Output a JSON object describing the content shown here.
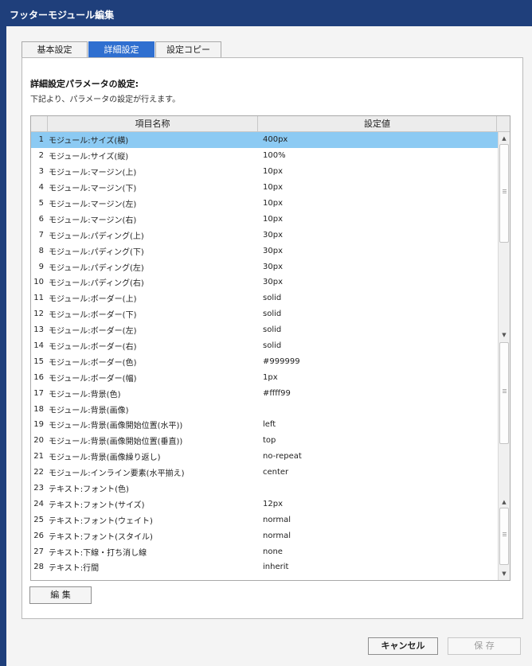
{
  "window": {
    "title": "フッターモジュール編集"
  },
  "tabs": [
    {
      "label": "基本設定",
      "active": false
    },
    {
      "label": "詳細設定",
      "active": true
    },
    {
      "label": "設定コピー",
      "active": false
    }
  ],
  "section": {
    "heading": "詳細設定パラメータの設定:",
    "description": "下記より、パラメータの設定が行えます。"
  },
  "grid": {
    "columns": {
      "name": "項目名称",
      "value": "設定値"
    },
    "rows": [
      {
        "no": "1",
        "name": "モジュール:サイズ(横)",
        "value": "400px",
        "selected": true
      },
      {
        "no": "2",
        "name": "モジュール:サイズ(縦)",
        "value": "100%"
      },
      {
        "no": "3",
        "name": "モジュール:マージン(上)",
        "value": "10px"
      },
      {
        "no": "4",
        "name": "モジュール:マージン(下)",
        "value": "10px"
      },
      {
        "no": "5",
        "name": "モジュール:マージン(左)",
        "value": "10px"
      },
      {
        "no": "6",
        "name": "モジュール:マージン(右)",
        "value": "10px"
      },
      {
        "no": "7",
        "name": "モジュール:パディング(上)",
        "value": "30px"
      },
      {
        "no": "8",
        "name": "モジュール:パディング(下)",
        "value": "30px"
      },
      {
        "no": "9",
        "name": "モジュール:パディング(左)",
        "value": "30px"
      },
      {
        "no": "10",
        "name": "モジュール:パディング(右)",
        "value": "30px"
      },
      {
        "no": "11",
        "name": "モジュール:ボーダー(上)",
        "value": "solid"
      },
      {
        "no": "12",
        "name": "モジュール:ボーダー(下)",
        "value": "solid"
      },
      {
        "no": "13",
        "name": "モジュール:ボーダー(左)",
        "value": "solid"
      },
      {
        "no": "14",
        "name": "モジュール:ボーダー(右)",
        "value": "solid"
      },
      {
        "no": "15",
        "name": "モジュール:ボーダー(色)",
        "value": "#999999"
      },
      {
        "no": "16",
        "name": "モジュール:ボーダー(幅)",
        "value": "1px"
      },
      {
        "no": "17",
        "name": "モジュール:背景(色)",
        "value": "#ffff99"
      },
      {
        "no": "18",
        "name": "モジュール:背景(画像)",
        "value": ""
      },
      {
        "no": "19",
        "name": "モジュール:背景(画像開始位置(水平))",
        "value": "left"
      },
      {
        "no": "20",
        "name": "モジュール:背景(画像開始位置(垂直))",
        "value": "top"
      },
      {
        "no": "21",
        "name": "モジュール:背景(画像繰り返し)",
        "value": "no-repeat"
      },
      {
        "no": "22",
        "name": "モジュール:インライン要素(水平揃え)",
        "value": "center"
      },
      {
        "no": "23",
        "name": "テキスト:フォント(色)",
        "value": ""
      },
      {
        "no": "24",
        "name": "テキスト:フォント(サイズ)",
        "value": "12px"
      },
      {
        "no": "25",
        "name": "テキスト:フォント(ウェイト)",
        "value": "normal"
      },
      {
        "no": "26",
        "name": "テキスト:フォント(スタイル)",
        "value": "normal"
      },
      {
        "no": "27",
        "name": "テキスト:下線・打ち消し線",
        "value": "none"
      },
      {
        "no": "28",
        "name": "テキスト:行間",
        "value": "inherit"
      }
    ]
  },
  "buttons": {
    "edit": "編 集",
    "cancel": "キャンセル",
    "save": "保 存"
  },
  "colors": {
    "titlebar": "#1f3f7b",
    "active_tab": "#2f6fd0",
    "selected_row": "#8ccaf3"
  },
  "icons": {
    "scroll_up": "triangle-up",
    "scroll_down": "triangle-down",
    "grip": "grip-lines"
  }
}
